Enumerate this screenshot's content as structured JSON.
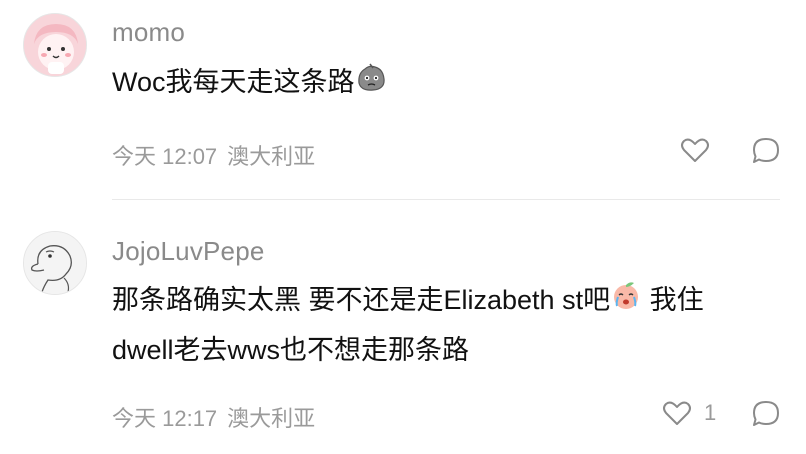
{
  "comments": [
    {
      "username": "momo",
      "text": "Woc我每天走这条路",
      "emoji": "rock-face-emoji",
      "time": "今天 12:07",
      "location": "澳大利亚",
      "like_count": "",
      "avatar": "pink-cartoon-avatar"
    },
    {
      "username": "JojoLuvPepe",
      "text_line1": "那条路确实太黑 要不还是走Elizabeth st吧",
      "emoji": "crying-peach-emoji",
      "text_line1_tail": " 我住",
      "text_line2": "dwell老去wws也不想走那条路",
      "time": "今天 12:17",
      "location": "澳大利亚",
      "like_count": "1",
      "avatar": "pepe-sketch-avatar"
    }
  ],
  "icons": {
    "like": "heart-outline-icon",
    "reply": "speech-bubble-icon"
  },
  "colors": {
    "meta_gray": "#9a9a9a",
    "username_gray": "#8a8a8a",
    "text": "#111111",
    "avatar_pink": "#f6c9cf"
  }
}
